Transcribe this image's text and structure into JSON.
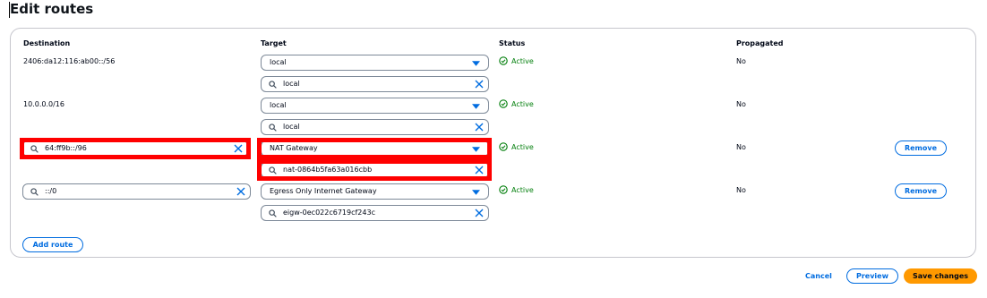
{
  "page": {
    "title": "Edit routes"
  },
  "table": {
    "headers": {
      "destination": "Destination",
      "target": "Target",
      "status": "Status",
      "propagated": "Propagated"
    },
    "rows": [
      {
        "destination": "2406:da12:116:ab00::/56",
        "target_type": "local",
        "target_value": "local",
        "status": "Active",
        "propagated": "No"
      },
      {
        "destination": "10.0.0.0/16",
        "target_type": "local",
        "target_value": "local",
        "status": "Active",
        "propagated": "No"
      },
      {
        "destination": "64:ff9b::/96",
        "target_type": "NAT Gateway",
        "target_value": "nat-0864b5fa63a016cbb",
        "status": "Active",
        "propagated": "No",
        "remove": "Remove"
      },
      {
        "destination": "::/0",
        "target_type": "Egress Only Internet Gateway",
        "target_value": "eigw-0ec022c6719cf243c",
        "status": "Active",
        "propagated": "No",
        "remove": "Remove"
      }
    ]
  },
  "actions": {
    "add_route": "Add route",
    "cancel": "Cancel",
    "preview": "Preview",
    "save": "Save changes"
  },
  "colors": {
    "link": "#006ce0",
    "primary": "#ff9900",
    "success": "#037f0c",
    "highlight": "#ff0000"
  }
}
